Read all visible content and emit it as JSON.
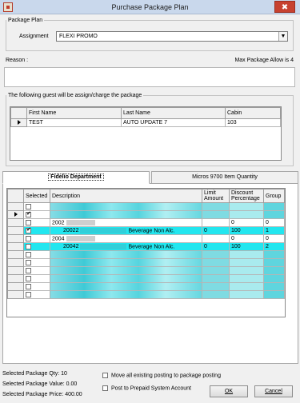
{
  "window": {
    "title": "Purchase Package Plan",
    "close_glyph": "✖"
  },
  "package_plan": {
    "legend": "Package Plan",
    "assignment_label": "Assignment",
    "assignment_value": "FLEXI PROMO"
  },
  "reason": {
    "label": "Reason :",
    "max_allow": "Max Package Allow is 4"
  },
  "guests": {
    "legend": "The following guest will be assign/charge the package",
    "columns": [
      "First Name",
      "Last Name",
      "Cabin"
    ],
    "rows": [
      {
        "first_name": "TEST",
        "last_name": "AUTO UPDATE 7",
        "cabin": "103"
      }
    ]
  },
  "tabs": [
    {
      "label": "Fidelio Department"
    },
    {
      "label": "Micros 9700 Item Quantity"
    }
  ],
  "items": {
    "columns": [
      "Selected",
      "Description",
      "Limit Amount",
      "Discount Percentage",
      "Group"
    ],
    "rows": [
      {
        "kind": "mosaic",
        "selected": false,
        "code": "",
        "desc": "",
        "limit": "",
        "discount": "",
        "group": ""
      },
      {
        "kind": "mosaic",
        "selected": true,
        "code": "",
        "desc": "",
        "limit": "",
        "discount": "",
        "group": ""
      },
      {
        "kind": "plain",
        "selected": false,
        "code": "2002",
        "desc": "",
        "limit": "",
        "discount": "0",
        "group": "0"
      },
      {
        "kind": "cyan",
        "selected": true,
        "code": "20022",
        "desc": "Beverage Non Alc.",
        "limit": "0",
        "discount": "100",
        "group": "1"
      },
      {
        "kind": "plain",
        "selected": false,
        "code": "2004",
        "desc": "",
        "limit": "",
        "discount": "0",
        "group": "0"
      },
      {
        "kind": "cyan",
        "selected": false,
        "code": "20042",
        "desc": "Beverage Non Alc.",
        "limit": "0",
        "discount": "100",
        "group": "2"
      },
      {
        "kind": "mosaic",
        "selected": false,
        "code": "",
        "desc": "",
        "limit": "",
        "discount": "",
        "group": ""
      },
      {
        "kind": "mosaic",
        "selected": false,
        "code": "",
        "desc": "",
        "limit": "",
        "discount": "",
        "group": ""
      },
      {
        "kind": "mosaic",
        "selected": false,
        "code": "",
        "desc": "",
        "limit": "",
        "discount": "",
        "group": ""
      },
      {
        "kind": "mosaic",
        "selected": false,
        "code": "",
        "desc": "",
        "limit": "",
        "discount": "",
        "group": ""
      },
      {
        "kind": "mosaic",
        "selected": false,
        "code": "",
        "desc": "",
        "limit": "",
        "discount": "",
        "group": ""
      },
      {
        "kind": "mosaic",
        "selected": false,
        "code": "",
        "desc": "",
        "limit": "",
        "discount": "",
        "group": ""
      }
    ]
  },
  "summary": {
    "qty": "Selected Package Qty: 10",
    "value": "Selected Package Value: 0.00",
    "price": "Selected Package Price: 400.00"
  },
  "options": {
    "move_postings": "Move all existing posting to package posting",
    "prepaid": "Post to Prepaid System Account"
  },
  "buttons": {
    "ok": "OK",
    "cancel": "Cancel"
  },
  "colors": {
    "highlight": "#22e6ef",
    "titlebar": "#c9d8ec",
    "close": "#c7412f"
  }
}
